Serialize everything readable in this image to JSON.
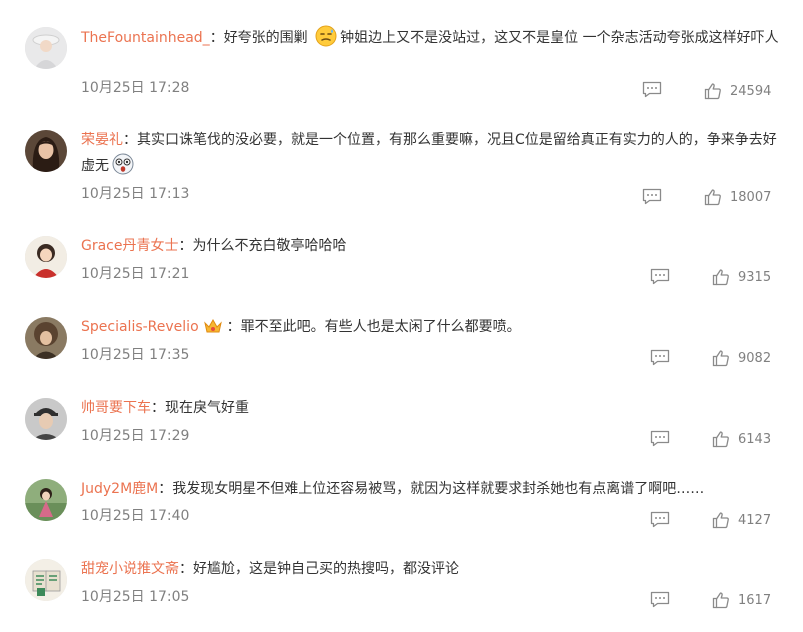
{
  "comments": [
    {
      "username": "TheFountainhead_",
      "separator": "：",
      "text_before_emoji": "好夸张的围剿 ",
      "emoji_name": "sweat-face-emoji",
      "text_after_emoji": "钟姐边上又不是没站过，这又不是皇位 一个杂志活动夸张成这样好吓人",
      "time": "10月25日 17:28",
      "likes": "24594",
      "avatar_icon": "avatar-woman-white-hat"
    },
    {
      "username": "荣晏礼",
      "separator": "：",
      "text_before_emoji": "其实口诛笔伐的没必要，就是一个位置，有那么重要嘛，况且C位是留给真正有实力的人的，争来争去好虚无",
      "emoji_name": "dizzy-face-emoji",
      "text_after_emoji": "",
      "time": "10月25日 17:13",
      "likes": "18007",
      "avatar_icon": "avatar-woman-dark-hair"
    },
    {
      "username": "Grace丹青女士",
      "separator": "：",
      "text_before_emoji": "为什么不充白敬亭哈哈哈",
      "emoji_name": "",
      "text_after_emoji": "",
      "time": "10月25日 17:21",
      "likes": "9315",
      "avatar_icon": "avatar-anime-girl-red"
    },
    {
      "username": "Specialis-Revelio",
      "separator": "：",
      "badge_name": "crown-badge-icon",
      "text_before_emoji": "罪不至此吧。有些人也是太闲了什么都要喷。",
      "emoji_name": "",
      "text_after_emoji": "",
      "time": "10月25日 17:35",
      "likes": "9082",
      "avatar_icon": "avatar-curly-hair-man"
    },
    {
      "username": "帅哥要下车",
      "separator": "：",
      "text_before_emoji": "现在戾气好重",
      "emoji_name": "",
      "text_after_emoji": "",
      "time": "10月25日 17:29",
      "likes": "6143",
      "avatar_icon": "avatar-man-cap"
    },
    {
      "username": "Judy2M鹿M",
      "separator": "：",
      "text_before_emoji": "我发现女明星不但难上位还容易被骂，就因为这样就要求封杀她也有点离谱了啊吧……",
      "emoji_name": "",
      "text_after_emoji": "",
      "time": "10月25日 17:40",
      "likes": "4127",
      "avatar_icon": "avatar-girl-outdoor"
    },
    {
      "username": "甜宠小说推文斋",
      "separator": "：",
      "text_before_emoji": "好尴尬，这是钟自己买的热搜吗，都没评论",
      "emoji_name": "",
      "text_after_emoji": "",
      "time": "10月25日 17:05",
      "likes": "1617",
      "avatar_icon": "avatar-book-logo"
    }
  ],
  "colors": {
    "username": "#eb7350",
    "text": "#333333",
    "meta": "#808080"
  },
  "icons": {
    "reply": "comment-bubble-icon",
    "like": "thumbs-up-icon"
  }
}
